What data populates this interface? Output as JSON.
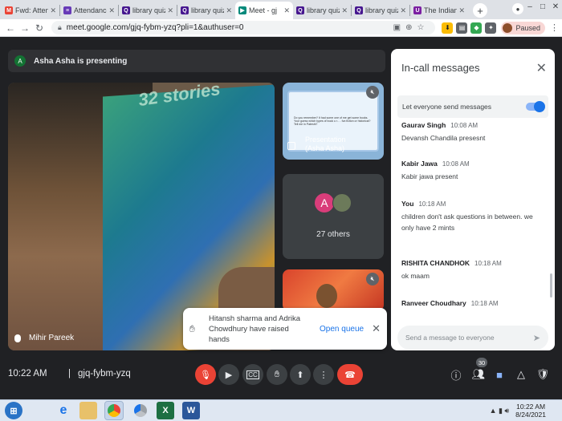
{
  "browser": {
    "tabs": [
      {
        "label": "Fwd: Attendan",
        "icon": "gmail-icon",
        "color": "#ea4335",
        "glyph": "M"
      },
      {
        "label": "Attendance-C",
        "icon": "forms-icon",
        "color": "#673ab7",
        "glyph": "≡"
      },
      {
        "label": "library quiz",
        "icon": "quiz-icon",
        "color": "#46178f",
        "glyph": "Q"
      },
      {
        "label": "library quiz | C",
        "icon": "quiz-icon",
        "color": "#46178f",
        "glyph": "Q"
      },
      {
        "label": "Meet - gj",
        "icon": "meet-icon",
        "color": "#00897b",
        "glyph": "▶",
        "active": true
      },
      {
        "label": "library quiz",
        "icon": "quiz-icon",
        "color": "#46178f",
        "glyph": "Q"
      },
      {
        "label": "library quiz | C",
        "icon": "quiz-icon",
        "color": "#46178f",
        "glyph": "Q"
      },
      {
        "label": "The Indian Sc",
        "icon": "site-icon",
        "color": "#7b1fa2",
        "glyph": "U"
      }
    ],
    "url": "meet.google.com/gjq-fybm-yzq?pli=1&authuser=0",
    "profile_status": "Paused"
  },
  "meeting": {
    "presenting_initial": "A",
    "presenting_text": "Asha Asha is presenting",
    "main_tile_book_title": "32 stories",
    "main_tile_name": "Mihir Pareek",
    "presentation_label": "Presentation\n(Asha Asha)",
    "presentation_slide_text": "Do you remember? It had some one of me get some books. Your guess which types of book u r…. fun fiction or historical? Tell me in Pateshi?",
    "others_initial": "A",
    "others_label": "27 others",
    "clock": "10:22 AM",
    "separator": "|",
    "meeting_code": "gjq-fybm-yzq",
    "participant_count": "30"
  },
  "toast": {
    "text": "Hitansh sharma and Adrika Chowdhury have raised hands",
    "button": "Open queue"
  },
  "chat": {
    "title": "In-call messages",
    "toggle_label": "Let everyone send messages",
    "toggle_on": true,
    "messages": [
      {
        "sender": "Gaurav Singh",
        "time": "10:08 AM",
        "text": "Devansh Chandila presesnt"
      },
      {
        "sender": "Kabir Jawa",
        "time": "10:08 AM",
        "text": "Kabir jawa present"
      },
      {
        "sender": "You",
        "time": "10:18 AM",
        "text": "children don't ask questions in between. we only have 2 mints"
      },
      {
        "sender": "RISHITA CHANDHOK",
        "time": "10:18 AM",
        "text": "ok maam"
      },
      {
        "sender": "Ranveer Choudhary",
        "time": "10:18 AM",
        "text": ""
      }
    ],
    "input_placeholder": "Send a message to everyone"
  },
  "taskbar": {
    "time": "10:22 AM",
    "date": "8/24/2021"
  },
  "colors": {
    "accent": "#1a73e8",
    "end_call": "#ea4335",
    "meet_bg": "#202124"
  }
}
